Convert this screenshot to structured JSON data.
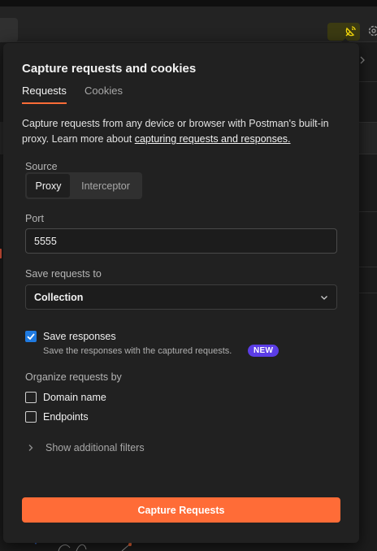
{
  "popover": {
    "title": "Capture requests and cookies",
    "tabs": [
      {
        "label": "Requests",
        "active": true
      },
      {
        "label": "Cookies",
        "active": false
      }
    ],
    "description_text": "Capture requests from any device or browser with Postman's built-in proxy. Learn more about ",
    "description_link": "capturing requests and responses.",
    "source": {
      "label": "Source",
      "options": [
        "Proxy",
        "Interceptor"
      ],
      "selected": "Proxy"
    },
    "port": {
      "label": "Port",
      "value": "5555"
    },
    "save_to": {
      "label": "Save requests to",
      "value": "Collection"
    },
    "save_responses": {
      "label": "Save responses",
      "checked": true,
      "help": "Save the responses with the captured requests.",
      "badge": "NEW"
    },
    "organize": {
      "label": "Organize requests by",
      "options": [
        {
          "label": "Domain name",
          "checked": false
        },
        {
          "label": "Endpoints",
          "checked": false
        }
      ]
    },
    "filters_label": "Show additional filters",
    "capture_button": "Capture Requests"
  },
  "colors": {
    "accent": "#ff6c37",
    "checkbox": "#1f7ae0",
    "badge": "#5b3de6",
    "capture_icon": "#f5d90a"
  },
  "icons": {
    "capture": "satellite-dish-icon",
    "settings": "gear-icon",
    "select": "chevron-down-icon",
    "filters": "chevron-right-icon"
  }
}
